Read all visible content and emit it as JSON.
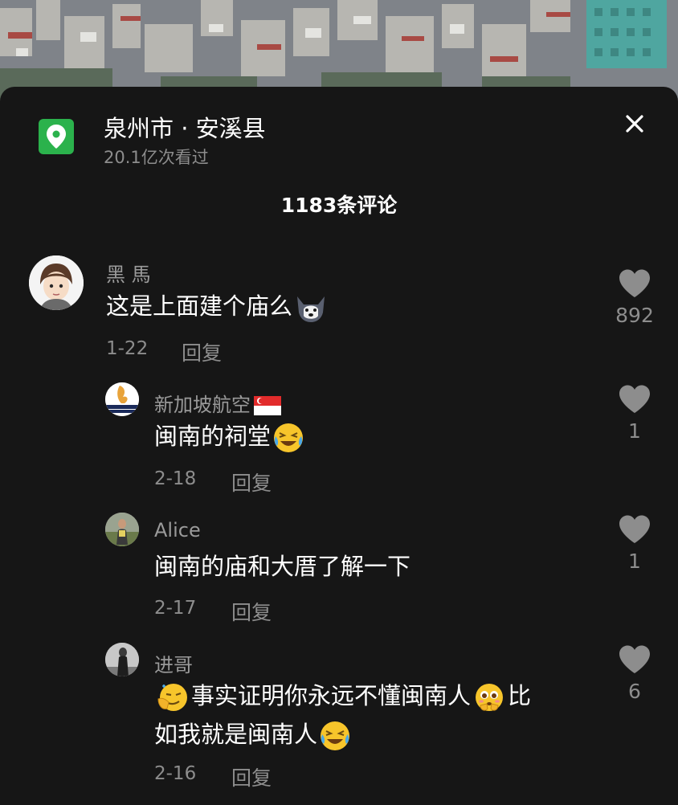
{
  "header": {
    "location": "泉州市 · 安溪县",
    "views": "20.1亿次看过",
    "comment_count": "1183条评论"
  },
  "icons": {
    "location": "map-pin-icon",
    "close": "close-icon",
    "like": "heart-icon"
  },
  "colors": {
    "accent_green": "#2bb24c",
    "sheet_bg": "#161616",
    "secondary_text": "#8d8d8d"
  },
  "comments": [
    {
      "user": "黑 馬",
      "text": "这是上面建个庙么",
      "date": "1-22",
      "reply": "回复",
      "likes": "892"
    },
    {
      "user": "新加坡航空",
      "text": "闽南的祠堂",
      "date": "2-18",
      "reply": "回复",
      "likes": "1"
    },
    {
      "user": "Alice",
      "text": "闽南的庙和大厝了解一下",
      "date": "2-17",
      "reply": "回复",
      "likes": "1"
    },
    {
      "user": "进哥",
      "text_part1": "事实证明你永远不懂闽南人",
      "text_part2": "比",
      "text_part3": "如我就是闽南人",
      "date": "2-16",
      "reply": "回复",
      "likes": "6"
    }
  ]
}
